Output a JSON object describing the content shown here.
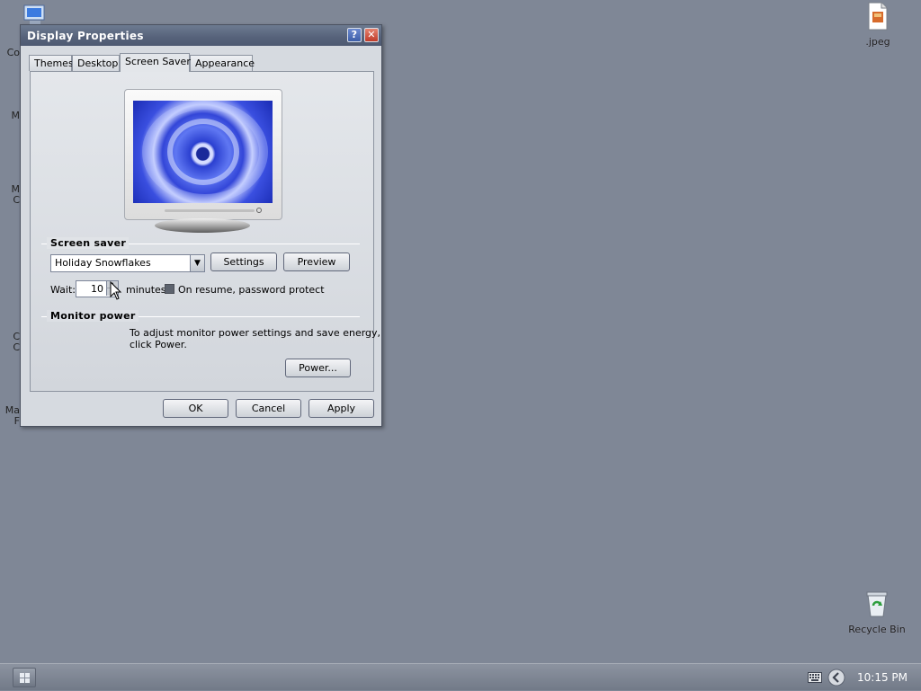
{
  "desktop": {
    "icons": {
      "jpeg_file": ".jpeg",
      "recycle_bin": "Recycle Bin"
    },
    "left_fragments": [
      "Co",
      "M",
      "M",
      "C",
      "C",
      "C",
      "Ma",
      "F"
    ]
  },
  "window": {
    "title": "Display Properties",
    "help_label": "?",
    "close_label": "✕",
    "tabs": [
      "Themes",
      "Desktop",
      "Screen Saver",
      "Appearance"
    ],
    "active_tab": "Screen Saver",
    "screen_saver": {
      "group_label": "Screen saver",
      "selected": "Holiday Snowflakes",
      "settings_button": "Settings",
      "preview_button": "Preview",
      "wait_label": "Wait:",
      "wait_value": "10",
      "minutes_label": "minutes",
      "password_protect_label": "On resume, password protect",
      "password_protect_checked": false
    },
    "monitor_power": {
      "group_label": "Monitor power",
      "description_line1": "To adjust monitor power settings and save energy,",
      "description_line2": "click Power.",
      "power_button": "Power..."
    },
    "footer": {
      "ok": "OK",
      "cancel": "Cancel",
      "apply": "Apply"
    }
  },
  "taskbar": {
    "clock": "10:15 PM"
  },
  "colors": {
    "desktop": "#7f8796",
    "titlebar": "#5a6680",
    "close": "#c84a38"
  }
}
